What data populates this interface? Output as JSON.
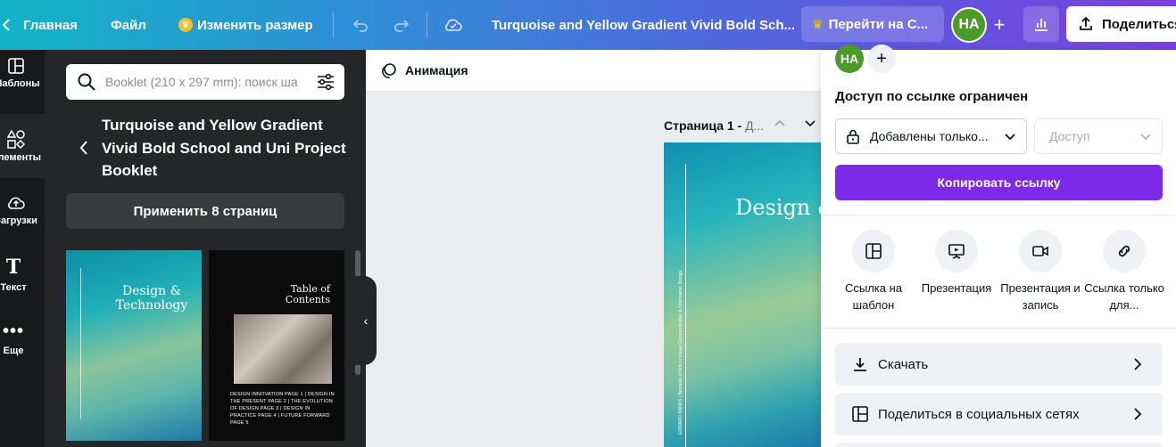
{
  "topbar": {
    "home": "Главная",
    "file": "Файл",
    "resize": "Изменить размер",
    "doc_title": "Turquoise and Yellow Gradient Vivid Bold Sch...",
    "upgrade": "Перейти на С...",
    "avatar": "НА",
    "plus": "+",
    "share": "Поделиться"
  },
  "rail": {
    "items": [
      {
        "label": "Шаблоны"
      },
      {
        "label": "Элементы"
      },
      {
        "label": "Загрузки"
      },
      {
        "label": "Текст"
      },
      {
        "label": "Еще"
      }
    ]
  },
  "panel": {
    "search_placeholder": "Booklet (210 x 297 mm): поиск ша",
    "template_title": "Turquoise and Yellow Gradient Vivid Bold School and Uni Project Booklet",
    "apply": "Применить 8 страниц",
    "thumb1_text": "Design & Technology",
    "thumb2_title": "Table of Contents",
    "thumb2_text": "DESIGN INNOVATION PAGE 1 | DESIGN IN THE PRESENT PAGE 2 | THE EVOLUTION OF DESIGN PAGE 3 | DESIGN IN PRACTICE PAGE 4 | FUTURE FORWARD PAGE 5"
  },
  "editor": {
    "animation": "Анимация",
    "page_label": "Страница 1 - ",
    "page_sub": "Д...",
    "canvas_title": "Design & Technology",
    "canvas_vertical": "EDWARD BANKS | Bachelor of Arts in Visual Communication & Information Design"
  },
  "share_panel": {
    "avatar": "НА",
    "plus": "+",
    "access_title": "Доступ по ссылке ограничен",
    "access_select": "Добавлены только...",
    "role_select": "Доступ",
    "copy_link": "Копировать ссылку",
    "options": [
      {
        "label": "Ссылка на шаблон"
      },
      {
        "label": "Презентация"
      },
      {
        "label": "Презентация и запись"
      },
      {
        "label": "Ссылка только для..."
      }
    ],
    "rows": [
      {
        "label": "Скачать"
      },
      {
        "label": "Поделиться в социальных сетях"
      }
    ]
  },
  "colors": {
    "accent": "#7d2ae8",
    "avatar": "#4c9a2a"
  }
}
